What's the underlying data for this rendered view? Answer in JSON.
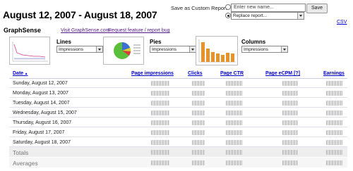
{
  "header": {
    "date_range": "August 12, 2007 - August 18, 2007",
    "save_as_label": "Save as Custom Report:",
    "name_placeholder": "Enter new name...",
    "replace_select_value": "Replace report...",
    "save_button": "Save",
    "csv_link": "CSV"
  },
  "brand": {
    "title": "GraphSense",
    "visit_link": "Visit GraphSense.com",
    "request_link": "Request feature / report bug"
  },
  "controls": {
    "lines": {
      "label": "Lines",
      "value": "Impressions"
    },
    "pies": {
      "label": "Pies",
      "value": "Impressions"
    },
    "columns": {
      "label": "Columns",
      "value": "Impressions"
    }
  },
  "table": {
    "headers": [
      "Date",
      "Page impressions",
      "Clicks",
      "Page CTR",
      "Page eCPM [?]",
      "Earnings"
    ],
    "rows": [
      "Sunday, August 12, 2007",
      "Monday, August 13, 2007",
      "Tuesday, August 14, 2007",
      "Wednesday, August 15, 2007",
      "Thursday, August 16, 2007",
      "Friday, August 17, 2007",
      "Saturday, August 18, 2007"
    ],
    "totals_label": "Totals",
    "averages_label": "Averages"
  },
  "colors": {
    "link": "#0000cc",
    "visited_link": "#551a8b",
    "totals_bg": "#eeeeee"
  },
  "icons": {
    "lines_thumb": "line-chart-icon",
    "pies_thumb": "pie-chart-icon",
    "columns_thumb": "bar-chart-icon"
  }
}
